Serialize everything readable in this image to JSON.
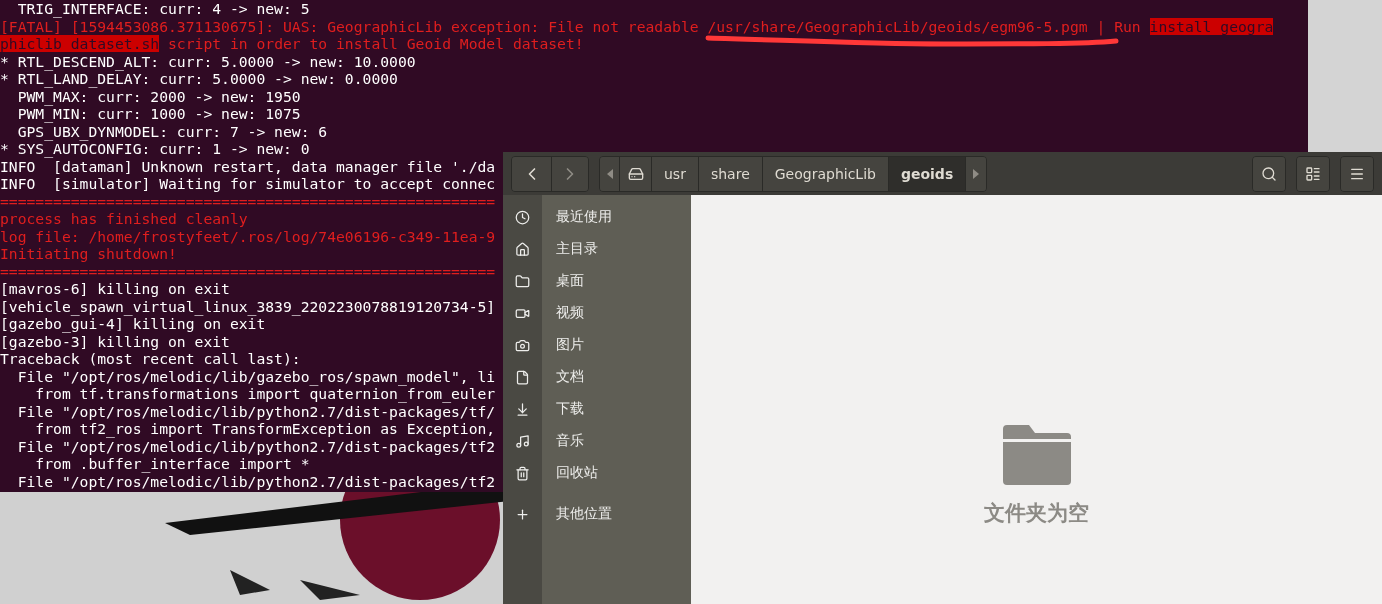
{
  "terminal": {
    "lines": [
      {
        "kind": "normal",
        "segments": [
          {
            "text": "  TRIG_INTERFACE: curr: 4 -> new: 5",
            "highlighted": false
          }
        ]
      },
      {
        "kind": "error",
        "segments": [
          {
            "text": "[FATAL] [1594453086.371130675]: UAS: GeographicLib exception: File not readable /usr/share/GeographicLib/geoids/egm96-5.pgm | Run ",
            "highlighted": false
          },
          {
            "text": "install geogra",
            "highlighted": true
          }
        ]
      },
      {
        "kind": "error",
        "segments": [
          {
            "text": "phiclib_dataset.sh",
            "highlighted": true
          },
          {
            "text": " script in order to install Geoid Model dataset!",
            "highlighted": false
          }
        ]
      },
      {
        "kind": "normal",
        "segments": [
          {
            "text": "* RTL_DESCEND_ALT: curr: 5.0000 -> new: 10.0000",
            "highlighted": false
          }
        ]
      },
      {
        "kind": "normal",
        "segments": [
          {
            "text": "* RTL_LAND_DELAY: curr: 5.0000 -> new: 0.0000",
            "highlighted": false
          }
        ]
      },
      {
        "kind": "normal",
        "segments": [
          {
            "text": "  PWM_MAX: curr: 2000 -> new: 1950",
            "highlighted": false
          }
        ]
      },
      {
        "kind": "normal",
        "segments": [
          {
            "text": "  PWM_MIN: curr: 1000 -> new: 1075",
            "highlighted": false
          }
        ]
      },
      {
        "kind": "normal",
        "segments": [
          {
            "text": "  GPS_UBX_DYNMODEL: curr: 7 -> new: 6",
            "highlighted": false
          }
        ]
      },
      {
        "kind": "normal",
        "segments": [
          {
            "text": "* SYS_AUTOCONFIG: curr: 1 -> new: 0",
            "highlighted": false
          }
        ]
      },
      {
        "kind": "normal",
        "segments": [
          {
            "text": "INFO  [dataman] Unknown restart, data manager file './da",
            "highlighted": false
          }
        ]
      },
      {
        "kind": "normal",
        "segments": [
          {
            "text": "INFO  [simulator] Waiting for simulator to accept connec",
            "highlighted": false
          }
        ]
      },
      {
        "kind": "error",
        "segments": [
          {
            "text": "========================================================",
            "highlighted": false
          }
        ]
      },
      {
        "kind": "error",
        "segments": [
          {
            "text": "process has finished cleanly",
            "highlighted": false
          }
        ]
      },
      {
        "kind": "error",
        "segments": [
          {
            "text": "log file: /home/frostyfeet/.ros/log/74e06196-c349-11ea-9",
            "highlighted": false
          }
        ]
      },
      {
        "kind": "error",
        "segments": [
          {
            "text": "Initiating shutdown!",
            "highlighted": false
          }
        ]
      },
      {
        "kind": "error",
        "segments": [
          {
            "text": "========================================================",
            "highlighted": false
          }
        ]
      },
      {
        "kind": "normal",
        "segments": [
          {
            "text": "[mavros-6] killing on exit",
            "highlighted": false
          }
        ]
      },
      {
        "kind": "normal",
        "segments": [
          {
            "text": "[vehicle_spawn_virtual_linux_3839_2202230078819120734-5]",
            "highlighted": false
          }
        ]
      },
      {
        "kind": "normal",
        "segments": [
          {
            "text": "[gazebo_gui-4] killing on exit",
            "highlighted": false
          }
        ]
      },
      {
        "kind": "normal",
        "segments": [
          {
            "text": "[gazebo-3] killing on exit",
            "highlighted": false
          }
        ]
      },
      {
        "kind": "normal",
        "segments": [
          {
            "text": "Traceback (most recent call last):",
            "highlighted": false
          }
        ]
      },
      {
        "kind": "normal",
        "segments": [
          {
            "text": "  File \"/opt/ros/melodic/lib/gazebo_ros/spawn_model\", li",
            "highlighted": false
          }
        ]
      },
      {
        "kind": "normal",
        "segments": [
          {
            "text": "    from tf.transformations import quaternion_from_euler",
            "highlighted": false
          }
        ]
      },
      {
        "kind": "normal",
        "segments": [
          {
            "text": "  File \"/opt/ros/melodic/lib/python2.7/dist-packages/tf/",
            "highlighted": false
          }
        ]
      },
      {
        "kind": "normal",
        "segments": [
          {
            "text": "    from tf2_ros import TransformException as Exception,",
            "highlighted": false
          }
        ]
      },
      {
        "kind": "normal",
        "segments": [
          {
            "text": "  File \"/opt/ros/melodic/lib/python2.7/dist-packages/tf2",
            "highlighted": false
          }
        ]
      },
      {
        "kind": "normal",
        "segments": [
          {
            "text": "    from .buffer_interface import *",
            "highlighted": false
          }
        ]
      },
      {
        "kind": "normal",
        "segments": [
          {
            "text": "  File \"/opt/ros/melodic/lib/python2.7/dist-packages/tf2",
            "highlighted": false
          }
        ]
      }
    ]
  },
  "file_manager": {
    "path": [
      {
        "label": "usr",
        "selected": false
      },
      {
        "label": "share",
        "selected": false
      },
      {
        "label": "GeographicLib",
        "selected": false
      },
      {
        "label": "geoids",
        "selected": true
      }
    ],
    "sidebar": {
      "items": [
        {
          "label": "最近使用"
        },
        {
          "label": "主目录"
        },
        {
          "label": "桌面"
        },
        {
          "label": "视频"
        },
        {
          "label": "图片"
        },
        {
          "label": "文档"
        },
        {
          "label": "下载"
        },
        {
          "label": "音乐"
        },
        {
          "label": "回收站"
        }
      ],
      "other_locations": "其他位置"
    },
    "empty_message": "文件夹为空"
  }
}
